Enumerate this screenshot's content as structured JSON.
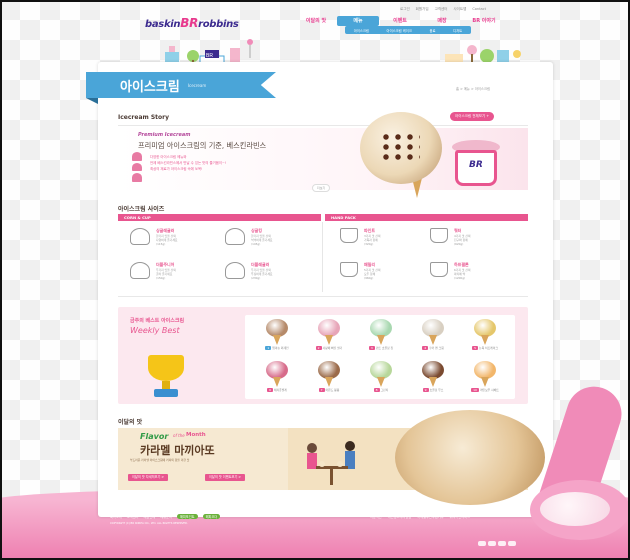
{
  "header": {
    "util_links": [
      "로그인",
      "회원가입",
      "고객센터",
      "사이트맵",
      "Contact"
    ],
    "logo_text": "baskin",
    "logo_br": "BR",
    "logo_text2": "robbins",
    "gnb": [
      "이달의 맛",
      "메뉴",
      "이벤트",
      "매장",
      "BR 이야기"
    ],
    "gnb_active": 1,
    "submenu": [
      "아이스크림",
      "아이스크림 케이크",
      "음료",
      "디저트"
    ]
  },
  "page": {
    "title": "아이스크림",
    "title_en": "Icecream",
    "breadcrumb": "홈 > 메뉴 > 아이스크림"
  },
  "story": {
    "heading": "Icecream Story",
    "button": "아이스크림 전체보기 +",
    "premium": "Premium Icecream",
    "title": "프리미엄 아이스크림의 기준, 베스킨라빈스",
    "bullets": [
      "다양한 아이스크림 메뉴와",
      "언제 베스킨라빈스에서 만날 수 있는 맛의 즐거움이~!",
      "최상의 재료가 아이스크림 속에 쏘옥!"
    ],
    "more": "더보기",
    "cup_logo": "BR"
  },
  "sizes": {
    "heading": "아이스크림 사이즈",
    "left_bar": "CORN & CUP",
    "right_bar": "HAND PACK",
    "items": [
      {
        "name": "싱글레귤러",
        "desc": [
          "한가지 맛을 선택",
          "다양하게 즐기세요",
          "(115g)"
        ]
      },
      {
        "name": "싱글킹",
        "desc": [
          "한가지 맛을 선택",
          "넉넉하게 즐기세요",
          "(145g)"
        ]
      },
      {
        "name": "파인트",
        "desc": [
          "3가지 맛 선택",
          "가족과 함께",
          "(320g)"
        ]
      },
      {
        "name": "쿼터",
        "desc": [
          "4가지 맛 선택",
          "친구와 함께",
          "(620g)"
        ]
      },
      {
        "name": "더블주니어",
        "desc": [
          "두가지 맛을 선택",
          "골라 즐기세요",
          "(150g)"
        ]
      },
      {
        "name": "더블레귤러",
        "desc": [
          "두가지 맛을 선택",
          "푸짐하게 즐기세요",
          "(230g)"
        ]
      },
      {
        "name": "패밀리",
        "desc": [
          "5가지 맛 선택",
          "모두 함께",
          "(960g)"
        ]
      },
      {
        "name": "하프갤론",
        "desc": [
          "6가지 맛 선택",
          "파티에 딱",
          "(1200g)"
        ]
      }
    ]
  },
  "weekly": {
    "title": "금주의 베스트 아이스크림",
    "subtitle": "Weekly Best",
    "items": [
      {
        "rank": "1",
        "name": "엄마는 외계인",
        "color": "#b58a6a"
      },
      {
        "rank": "2",
        "name": "사랑에 빠진 딸기",
        "color": "#e7a5b8"
      },
      {
        "rank": "3",
        "name": "민트 초콜릿 칩",
        "color": "#a8d8b0"
      },
      {
        "rank": "4",
        "name": "쿠키 앤 크림",
        "color": "#d8cfc1"
      },
      {
        "rank": "5",
        "name": "뉴욕 치즈케이크",
        "color": "#e5c76b"
      },
      {
        "rank": "6",
        "name": "체리쥬빌레",
        "color": "#d76b8a"
      },
      {
        "rank": "7",
        "name": "아몬드 봉봉",
        "color": "#9b6b4a"
      },
      {
        "rank": "8",
        "name": "그린티",
        "color": "#b7d79a"
      },
      {
        "rank": "9",
        "name": "초콜릿 무스",
        "color": "#7a4a30"
      },
      {
        "rank": "10",
        "name": "레인보우 샤베트",
        "color": "#f2b66a"
      }
    ]
  },
  "flavor": {
    "heading": "이달의 맛",
    "flavor_word": "Flavor",
    "of_the": "of the",
    "month_word": "Month",
    "name": "카라멜 마끼아또",
    "desc": "부드러운 카라멜 아이스크림에 커피의 향을 더한 맛",
    "btn1": "이달의 맛 자세히보기 >",
    "btn2": "이달의 맛 이벤트보기 >"
  },
  "footer": {
    "links": [
      "회사소개",
      "고객센터",
      "채용안내",
      "제휴문의"
    ],
    "pills": [
      "해피포인트",
      "해피오더"
    ],
    "links2": [
      "이용약관",
      "개인정보처리방침",
      "이메일무단수집거부",
      "위치기반서비스"
    ],
    "copyright": "COPYRIGHT (C) BR KOREA CO., LTD. ALL RIGHTS RESERVED."
  },
  "colors": {
    "pink": "#e8558f",
    "blue": "#4aa5d8",
    "brown": "#5a4a42"
  }
}
